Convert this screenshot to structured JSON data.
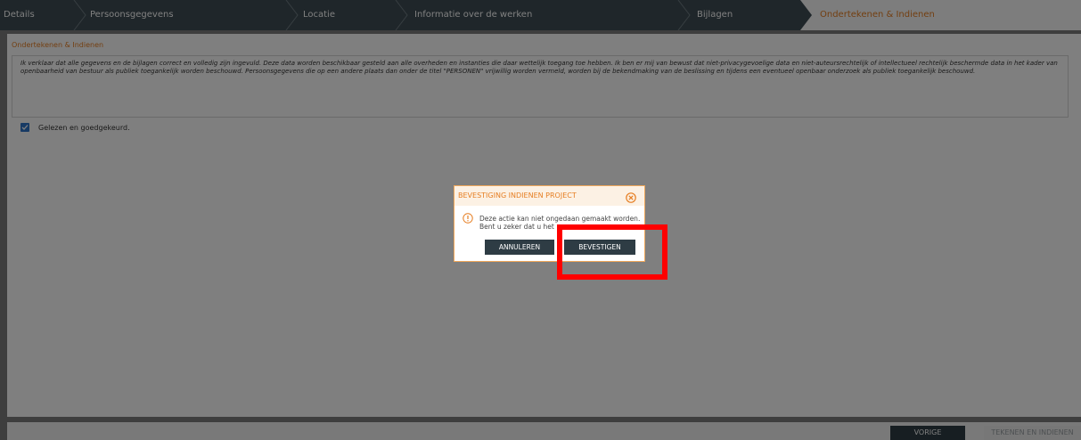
{
  "stepper": {
    "steps": [
      {
        "label": "Details"
      },
      {
        "label": "Persoonsgegevens"
      },
      {
        "label": "Locatie"
      },
      {
        "label": "Informatie over de werken"
      },
      {
        "label": "Bijlagen"
      },
      {
        "label": "Ondertekenen & Indienen",
        "active": true
      }
    ]
  },
  "section": {
    "title": "Ondertekenen & Indienen",
    "declaration": "Ik verklaar dat alle gegevens en de bijlagen correct en volledig zijn ingevuld. Deze data worden beschikbaar gesteld aan alle overheden en instanties die daar wettelijk toegang toe hebben. Ik ben er mij van bewust dat niet-privacygevoelige data en niet-auteursrechtelijk of intellectueel rechtelijk beschermde data in het kader van openbaarheid van bestuur als publiek toegankelijk worden beschouwd. Persoonsgegevens die op een andere plaats dan onder de titel \"PERSONEN\" vrijwillig worden vermeld, worden bij de bekendmaking van de beslissing en tijdens een eventueel openbaar onderzoek als publiek toegankelijk beschouwd.",
    "checkbox_label": "Gelezen en goedgekeurd.",
    "checkbox_checked": true
  },
  "footer": {
    "prev_label": "VORIGE",
    "submit_label": "TEKENEN EN INDIENEN"
  },
  "dialog": {
    "title": "BEVESTIGING INDIENEN PROJECT",
    "message_line1": "Deze actie kan niet ongedaan gemaakt worden.",
    "message_line2": "Bent u zeker dat u het",
    "cancel_label": "ANNULEREN",
    "confirm_label": "BEVESTIGEN"
  },
  "colors": {
    "accent": "#e67e22",
    "header_bg": "#3e4d55",
    "button_bg": "#2e3c44",
    "highlight": "#ff0000"
  }
}
